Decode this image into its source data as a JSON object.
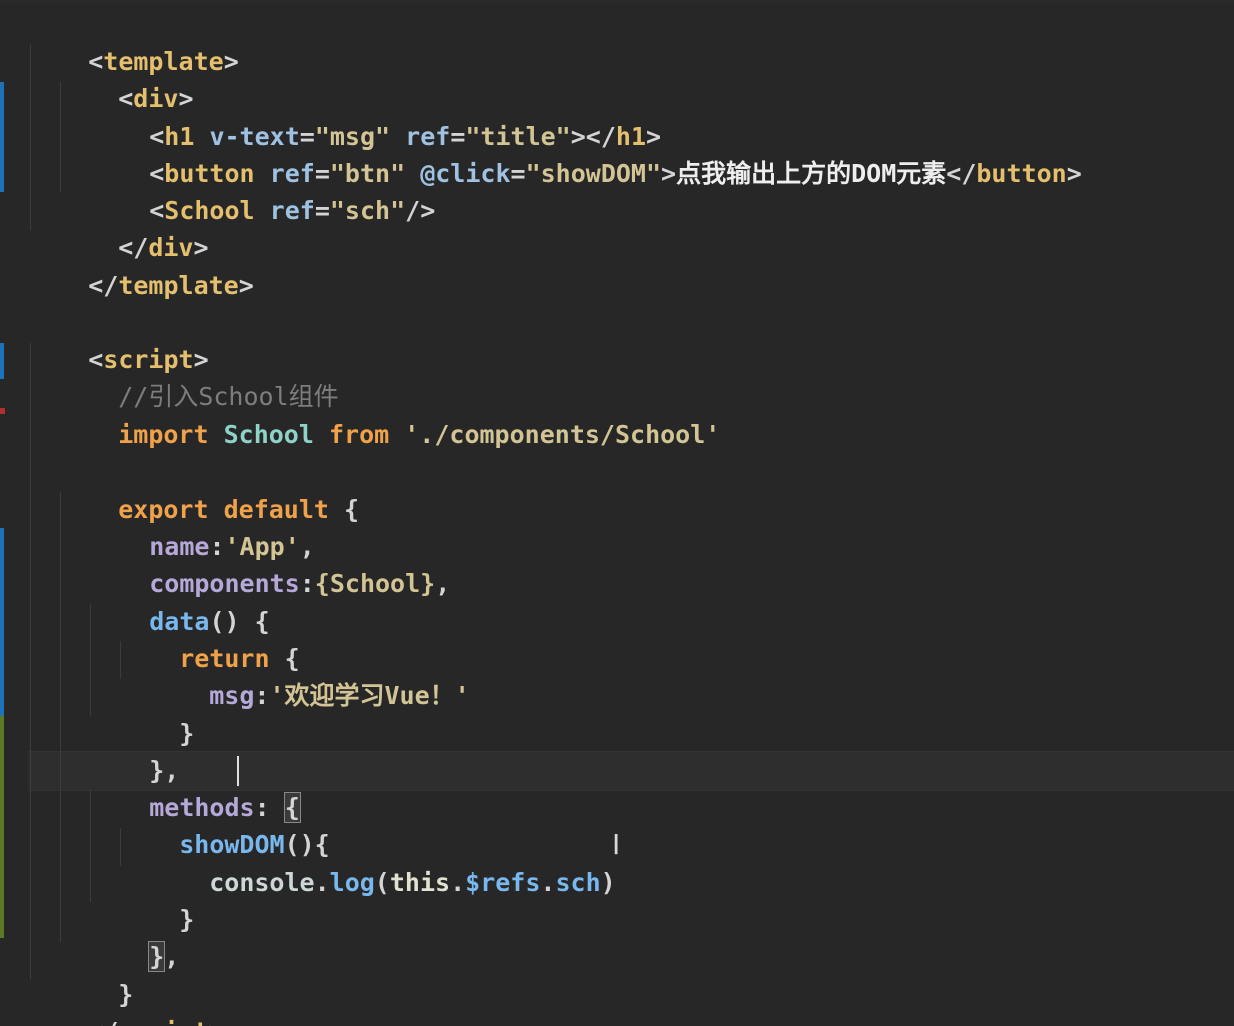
{
  "editor": {
    "colors": {
      "background": "#272727",
      "tag": "#e3bf6e",
      "attribute": "#9fc2e2",
      "string": "#d2c494",
      "keyword": "#f0a24b",
      "comment": "#7d7d7d",
      "gutter_modified": "#1e73b8",
      "gutter_added": "#5a7a23",
      "gutter_deleted": "#b03030"
    },
    "lines": {
      "l1": {
        "open": "<",
        "tag": "template",
        "close": ">"
      },
      "l2": {
        "open": "<",
        "tag": "div",
        "close": ">"
      },
      "l3": {
        "open": "<",
        "tag": "h1",
        "a1": "v-text",
        "eq1": "=",
        "v1": "\"msg\"",
        "a2": "ref",
        "eq2": "=",
        "v2": "\"title\"",
        "mid": "></",
        "tag2": "h1",
        "close": ">"
      },
      "l4": {
        "open": "<",
        "tag": "button",
        "a1": "ref",
        "eq1": "=",
        "v1": "\"btn\"",
        "a2": "@click",
        "eq2": "=",
        "v2": "\"showDOM\"",
        "gt": ">",
        "text": "点我输出上方的DOM元素",
        "endopen": "</",
        "tag2": "button",
        "close": ">"
      },
      "l5": {
        "open": "<",
        "tag": "School",
        "a1": "ref",
        "eq1": "=",
        "v1": "\"sch\"",
        "close": "/>"
      },
      "l6": {
        "open": "</",
        "tag": "div",
        "close": ">"
      },
      "l7": {
        "open": "</",
        "tag": "template",
        "close": ">"
      },
      "l9": {
        "open": "<",
        "tag": "script",
        "close": ">"
      },
      "l10": {
        "comment": "//引入School组件"
      },
      "l11": {
        "kw1": "import",
        "ident": "School",
        "kw2": "from",
        "path": "'./components/School'"
      },
      "l13": {
        "kw1": "export",
        "kw2": "default",
        "brace": "{"
      },
      "l14": {
        "key": "name",
        "colon": ":",
        "value": "'App'",
        "comma": ","
      },
      "l15": {
        "key": "components",
        "colon": ":",
        "value": "{School}",
        "comma": ","
      },
      "l16": {
        "fn": "data",
        "parens": "()",
        "brace": "{"
      },
      "l17": {
        "kw": "return",
        "brace": "{"
      },
      "l18": {
        "key": "msg",
        "colon": ":",
        "value": "'欢迎学习Vue！'"
      },
      "l19": {
        "brace": "}"
      },
      "l20": {
        "brace": "},",
        "comma": ","
      },
      "l21": {
        "key": "methods",
        "colon": ": ",
        "brace": "{"
      },
      "l22": {
        "fn": "showDOM",
        "parens": "(){",
        "brace": ""
      },
      "l23": {
        "obj": "console",
        "dot": ".",
        "method": "log",
        "lp": "(",
        "this": "this",
        "dot2": ".",
        "refs": "$refs",
        "dot3": ".",
        "prop": "sch",
        "rp": ")"
      },
      "l24": {
        "brace": "}"
      },
      "l25": {
        "brace": "}",
        "comma": ","
      },
      "l26": {
        "brace": "}"
      },
      "l27": {
        "open": "</",
        "tag": "script",
        "close": ">"
      }
    }
  }
}
